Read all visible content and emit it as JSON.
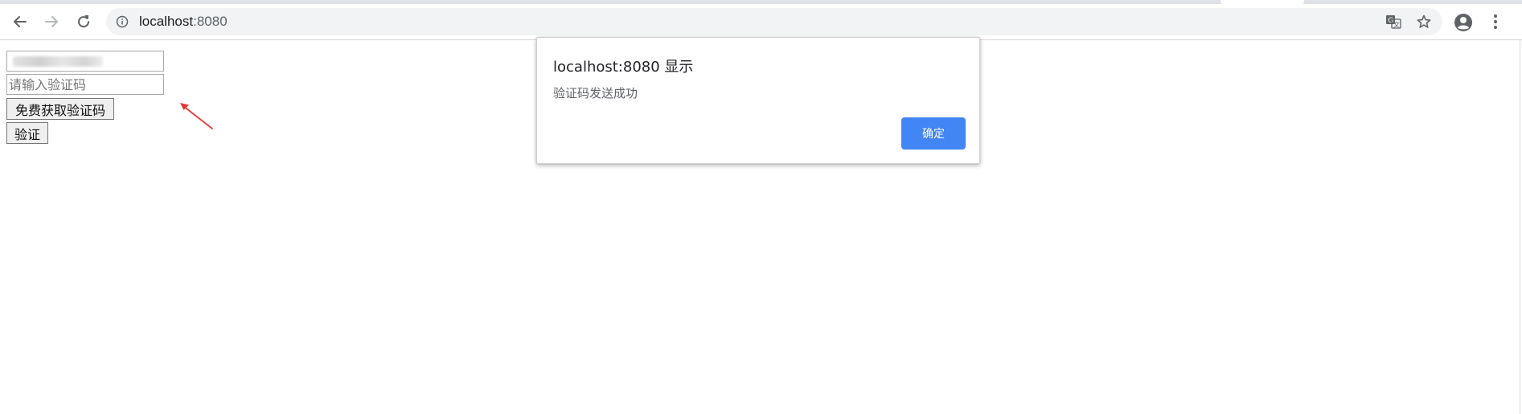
{
  "browser": {
    "url_host": "localhost",
    "url_port": ":8080",
    "icons": {
      "back": "arrow-left-icon",
      "forward": "arrow-right-icon",
      "reload": "reload-icon",
      "site_info": "info-icon",
      "translate": "translate-icon",
      "bookmark": "star-icon",
      "profile": "account-circle-icon",
      "menu": "kebab-menu-icon"
    }
  },
  "page": {
    "phone_field": {
      "value": "",
      "obscured": true
    },
    "code_field": {
      "placeholder": "请输入验证码",
      "value": ""
    },
    "send_code_button": "免费获取验证码",
    "verify_button": "验证",
    "annotation_color": "#e53935"
  },
  "dialog": {
    "title": "localhost:8080 显示",
    "message": "验证码发送成功",
    "ok_button": "确定",
    "accent_color": "#4285f4"
  }
}
